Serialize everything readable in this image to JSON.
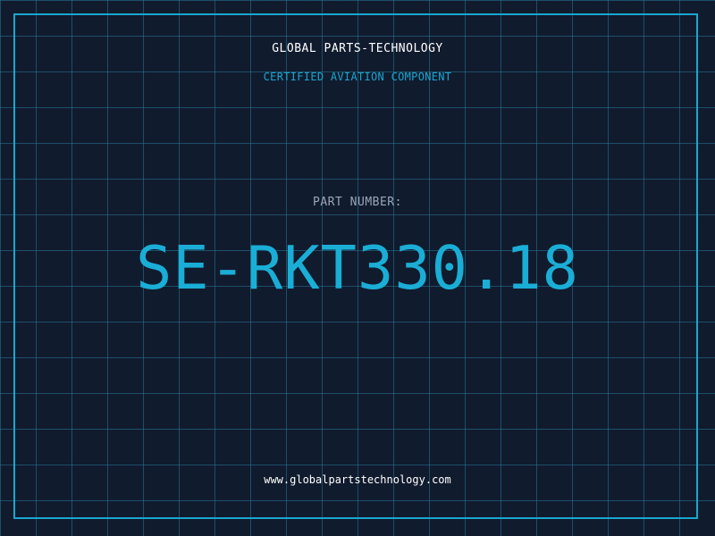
{
  "company_name": "GLOBAL PARTS-TECHNOLOGY",
  "tagline": "CERTIFIED AVIATION COMPONENT",
  "part_number_label": "PART NUMBER:",
  "part_number": "SE-RKT330.18",
  "website": "www.globalpartstechnology.com",
  "colors": {
    "background": "#111b2e",
    "grid": "#26788f",
    "accent": "#1aa6cf",
    "label": "#9aa6b8",
    "text": "#ffffff"
  }
}
